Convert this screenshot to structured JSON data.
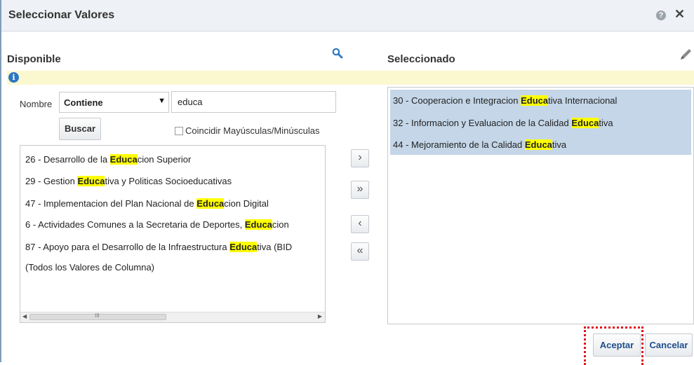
{
  "dialog": {
    "title": "Seleccionar Valores",
    "help_glyph": "?",
    "close_glyph": "✕"
  },
  "available": {
    "header": "Disponible",
    "info_glyph": "i",
    "filter_label": "Nombre",
    "operator_value": "Contiene",
    "search_value": "educa",
    "search_button": "Buscar",
    "match_case_label": "Coincidir Mayúsculas/Minúsculas",
    "items": [
      {
        "pre": "26 - Desarrollo de la ",
        "hl": "Educa",
        "post": "cion Superior"
      },
      {
        "pre": "29 - Gestion ",
        "hl": "Educa",
        "post": "tiva y Politicas Socioeducativas"
      },
      {
        "pre": "47 - Implementacion del Plan Nacional de ",
        "hl": "Educa",
        "post": "cion Digital"
      },
      {
        "pre": "6 - Actividades Comunes a la Secretaria de Deportes, ",
        "hl": "Educa",
        "post": "cion"
      },
      {
        "pre": "87 - Apoyo para el Desarrollo de la Infraestructura ",
        "hl": "Educa",
        "post": "tiva (BID"
      },
      {
        "pre": "(Todos los Valores de Columna)",
        "hl": "",
        "post": ""
      }
    ],
    "scroll_grip": "III"
  },
  "selected": {
    "header": "Seleccionado",
    "items": [
      {
        "pre": "30 - Cooperacion e Integracion ",
        "hl": "Educa",
        "post": "tiva Internacional"
      },
      {
        "pre": "32 - Informacion y Evaluacion de la Calidad ",
        "hl": "Educa",
        "post": "tiva"
      },
      {
        "pre": "44 - Mejoramiento de la Calidad ",
        "hl": "Educa",
        "post": "tiva"
      }
    ]
  },
  "shuttle": {
    "move": "›",
    "move_all": "»",
    "remove": "‹",
    "remove_all": "«"
  },
  "footer": {
    "ok": "Aceptar",
    "cancel": "Cancelar"
  },
  "colors": {
    "highlight": "#ffff00",
    "selection": "#c4d6e8",
    "info_bar": "#fbf8cf",
    "annotation": "#e0141e"
  },
  "icons": {
    "search": "magnifier-icon",
    "edit": "pencil-icon",
    "info": "info-icon",
    "help": "help-icon",
    "close": "close-icon"
  }
}
